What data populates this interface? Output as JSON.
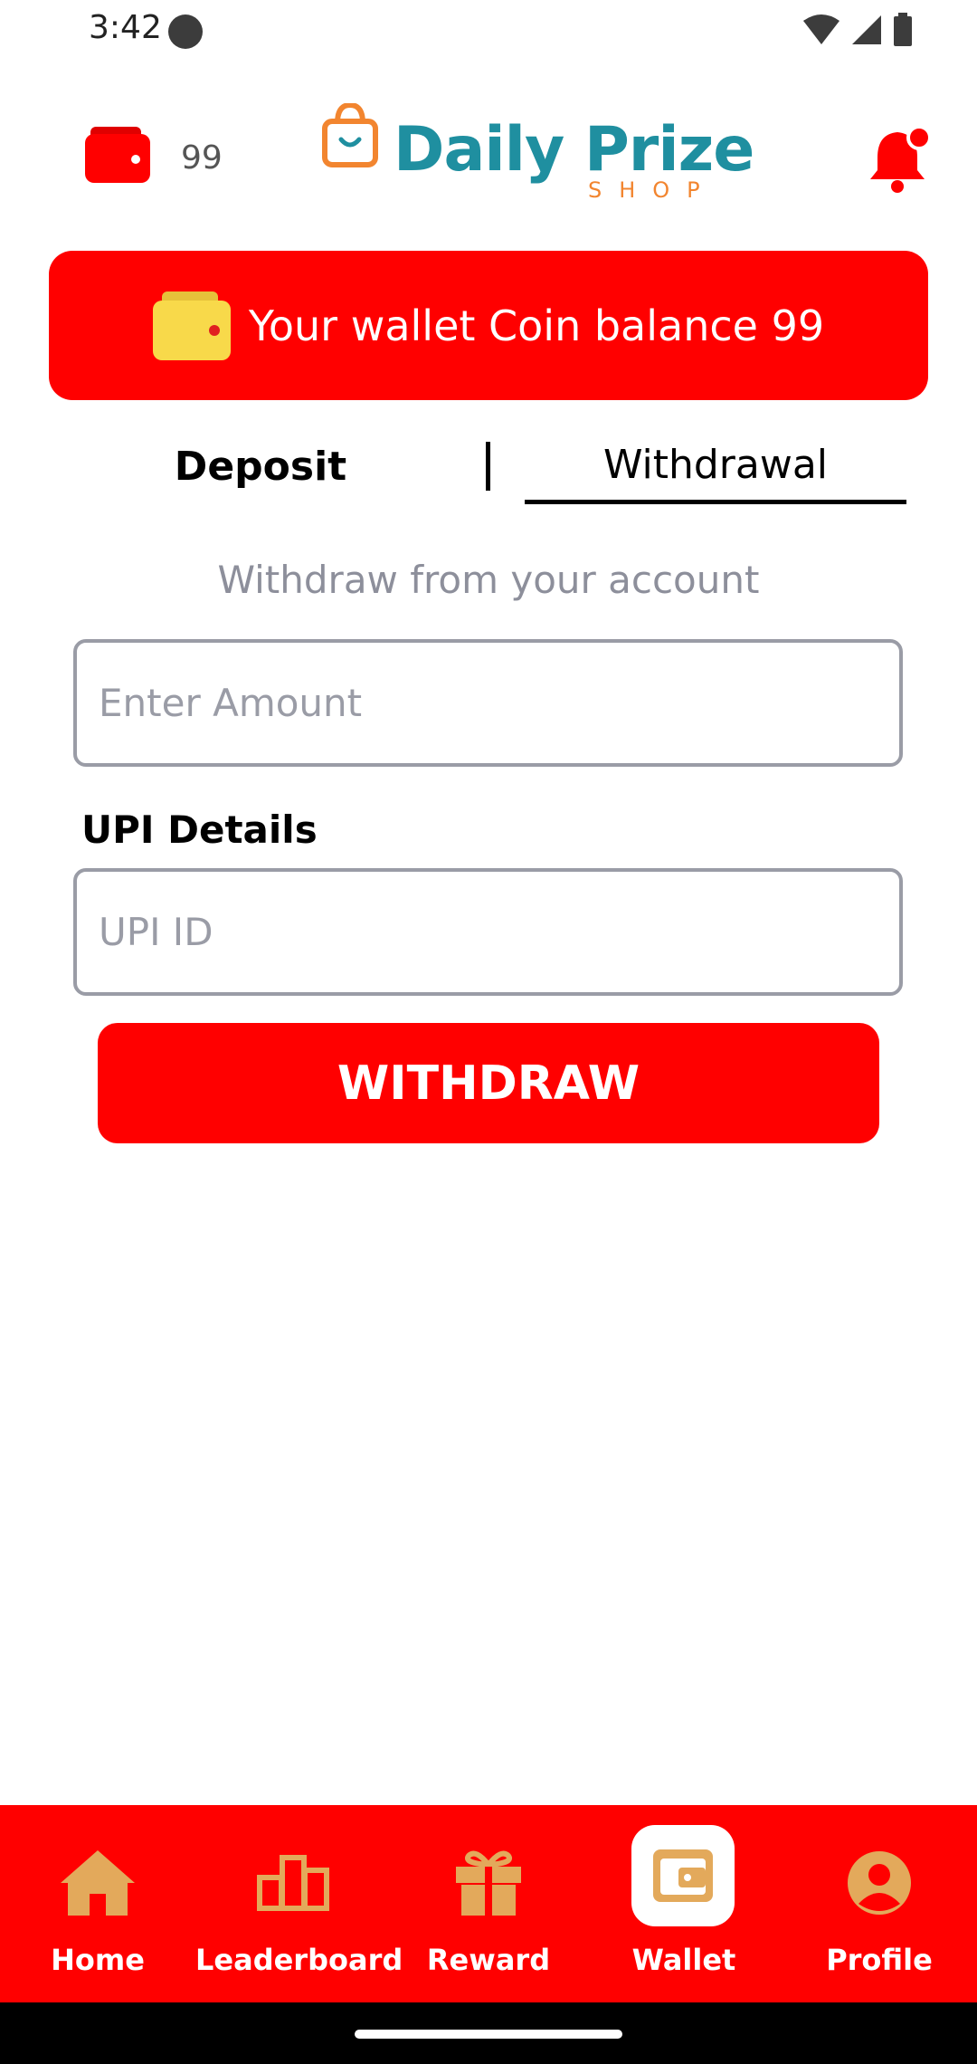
{
  "status_bar": {
    "time": "3:42"
  },
  "header": {
    "coins": "99",
    "logo_title": "Daily Prize",
    "logo_subtitle": "SHOP"
  },
  "balance_banner": {
    "text": "Your wallet Coin balance 99"
  },
  "tabs": {
    "deposit": "Deposit",
    "withdrawal": "Withdrawal",
    "active": "Withdrawal"
  },
  "form": {
    "heading": "Withdraw from your account",
    "amount_placeholder": "Enter Amount",
    "amount_value": "",
    "upi_label": "UPI Details",
    "upi_placeholder": "UPI ID",
    "upi_value": "",
    "submit_label": "WITHDRAW"
  },
  "bottom_nav": {
    "items": [
      {
        "label": "Home",
        "icon": "home-icon"
      },
      {
        "label": "Leaderboard",
        "icon": "leaderboard-icon"
      },
      {
        "label": "Reward",
        "icon": "gift-icon"
      },
      {
        "label": "Wallet",
        "icon": "wallet-icon"
      },
      {
        "label": "Profile",
        "icon": "profile-icon"
      }
    ],
    "active": "Wallet"
  },
  "colors": {
    "brand_red": "#ff0000",
    "icon_gold": "#e3a95b",
    "logo_teal": "#1f8fa0",
    "logo_orange": "#f2852f",
    "wallet_yellow": "#f8d94a"
  }
}
